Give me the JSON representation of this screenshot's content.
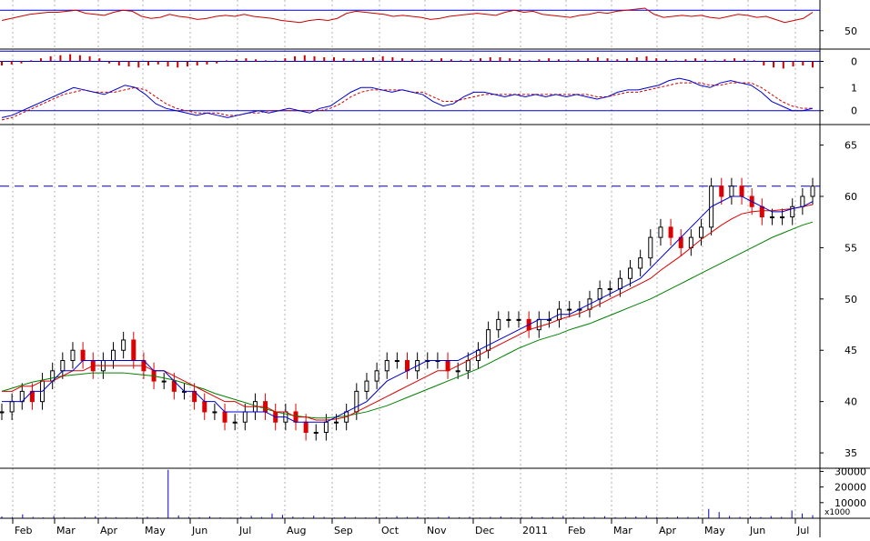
{
  "chart_data": {
    "type": "line",
    "title": "",
    "xlabel": "",
    "ylabel": "",
    "x_ticks": [
      "Feb",
      "Mar",
      "Apr",
      "May",
      "Jun",
      "Jul",
      "Aug",
      "Sep",
      "Oct",
      "Nov",
      "Dec",
      "2011",
      "Feb",
      "Mar",
      "Apr",
      "May",
      "Jun",
      "Jul"
    ],
    "grid": true,
    "panels": {
      "rsi": {
        "ylim": [
          32,
          80
        ],
        "ticks": [
          50
        ],
        "reference_lines": [
          70,
          30
        ],
        "color": "#cc0000",
        "values": [
          60,
          62,
          64,
          66,
          67,
          68,
          68,
          69,
          70,
          67,
          66,
          65,
          68,
          70,
          69,
          64,
          62,
          63,
          66,
          64,
          63,
          61,
          62,
          64,
          65,
          64,
          66,
          64,
          63,
          62,
          60,
          59,
          58,
          60,
          61,
          60,
          62,
          67,
          69,
          68,
          67,
          66,
          64,
          65,
          64,
          63,
          61,
          62,
          64,
          65,
          66,
          67,
          66,
          65,
          68,
          70,
          68,
          69,
          66,
          65,
          64,
          63,
          65,
          66,
          68,
          67,
          69,
          70,
          71,
          72,
          66,
          63,
          64,
          65,
          64,
          65,
          63,
          62,
          64,
          66,
          65,
          63,
          64,
          61,
          58,
          60,
          62,
          68
        ]
      },
      "macd_histogram": {
        "ylim": [
          -1.2,
          1.2
        ],
        "ticks": [
          0
        ],
        "color": "#cc0000",
        "values": [
          -0.4,
          -0.3,
          -0.2,
          0.1,
          0.3,
          0.5,
          0.6,
          0.7,
          0.6,
          0.5,
          0.3,
          -0.2,
          -0.4,
          -0.5,
          -0.6,
          -0.4,
          -0.3,
          -0.5,
          -0.6,
          -0.5,
          -0.4,
          -0.3,
          -0.2,
          0.1,
          0.2,
          0.3,
          0.2,
          0.1,
          0.1,
          0.3,
          0.5,
          0.6,
          0.5,
          0.4,
          0.4,
          0.3,
          0.2,
          0.3,
          0.4,
          0.5,
          0.4,
          0.3,
          0.2,
          0.1,
          0.2,
          0.3,
          0.2,
          0.1,
          0.2,
          0.3,
          0.4,
          0.4,
          0.3,
          0.2,
          0.1,
          0.2,
          0.3,
          0.2,
          0.1,
          0.2,
          0.3,
          0.4,
          0.3,
          0.2,
          0.3,
          0.4,
          0.5,
          0.3,
          0.2,
          0.1,
          0.2,
          0.3,
          0.2,
          0.1,
          0.2,
          0.3,
          0.2,
          0.1,
          -0.4,
          -0.6,
          -0.7,
          -0.5,
          -0.4,
          -0.6
        ]
      },
      "macd": {
        "ylim": [
          -0.6,
          1.6
        ],
        "ticks": [
          1,
          0
        ],
        "macd_color": "#0000cc",
        "signal_color": "#cc0000",
        "macd": [
          -0.3,
          -0.2,
          0.0,
          0.2,
          0.4,
          0.6,
          0.8,
          1.0,
          0.9,
          0.8,
          0.7,
          0.9,
          1.1,
          1.0,
          0.7,
          0.3,
          0.1,
          0.0,
          -0.1,
          -0.2,
          -0.1,
          -0.2,
          -0.3,
          -0.2,
          -0.1,
          0.0,
          -0.1,
          0.0,
          0.1,
          0.0,
          -0.1,
          0.1,
          0.2,
          0.5,
          0.8,
          1.0,
          1.0,
          0.9,
          0.8,
          0.9,
          0.8,
          0.7,
          0.4,
          0.2,
          0.3,
          0.6,
          0.8,
          0.8,
          0.7,
          0.6,
          0.7,
          0.6,
          0.7,
          0.6,
          0.7,
          0.6,
          0.7,
          0.6,
          0.5,
          0.6,
          0.8,
          0.9,
          0.9,
          1.0,
          1.1,
          1.3,
          1.4,
          1.3,
          1.1,
          1.0,
          1.2,
          1.3,
          1.2,
          1.1,
          0.8,
          0.4,
          0.2,
          0.0,
          0.0,
          0.1
        ],
        "signal": [
          -0.4,
          -0.3,
          -0.1,
          0.1,
          0.3,
          0.5,
          0.7,
          0.8,
          0.9,
          0.8,
          0.8,
          0.8,
          0.9,
          1.0,
          0.9,
          0.6,
          0.3,
          0.1,
          0.0,
          -0.1,
          -0.1,
          -0.1,
          -0.2,
          -0.2,
          -0.1,
          -0.1,
          0.0,
          0.0,
          0.0,
          0.0,
          0.0,
          0.0,
          0.1,
          0.3,
          0.6,
          0.8,
          0.9,
          0.9,
          0.9,
          0.9,
          0.8,
          0.8,
          0.6,
          0.4,
          0.4,
          0.5,
          0.6,
          0.7,
          0.7,
          0.7,
          0.7,
          0.7,
          0.7,
          0.7,
          0.7,
          0.7,
          0.7,
          0.7,
          0.6,
          0.6,
          0.7,
          0.8,
          0.8,
          0.9,
          1.0,
          1.1,
          1.2,
          1.2,
          1.2,
          1.1,
          1.1,
          1.2,
          1.2,
          1.2,
          1.0,
          0.7,
          0.4,
          0.2,
          0.1,
          0.1
        ]
      },
      "price": {
        "ylim": [
          33.5,
          67
        ],
        "ticks": [
          65,
          60,
          55,
          50,
          45,
          40,
          35
        ],
        "dashed_level": 61,
        "close": [
          39,
          40,
          41,
          40,
          42,
          43,
          44,
          45,
          44,
          43,
          44,
          45,
          46,
          44,
          43,
          42,
          42,
          41,
          41,
          40,
          39,
          39,
          38,
          38,
          39,
          40,
          39,
          38,
          39,
          38,
          37,
          37,
          38,
          38,
          39,
          41,
          42,
          43,
          44,
          44,
          43,
          44,
          44,
          44,
          43,
          43,
          44,
          45,
          47,
          48,
          48,
          48,
          47,
          48,
          48,
          49,
          49,
          49,
          50,
          51,
          51,
          52,
          53,
          54,
          56,
          57,
          56,
          55,
          56,
          57,
          61,
          60,
          61,
          60,
          59,
          58,
          58,
          58,
          59,
          60,
          61
        ],
        "ma_short": [
          40,
          40,
          40,
          41,
          41,
          42,
          43,
          43,
          44,
          44,
          44,
          44,
          44,
          44,
          44,
          43,
          43,
          42,
          41,
          41,
          40,
          40,
          39,
          39,
          39,
          39,
          39,
          38.5,
          38.5,
          38,
          38,
          38,
          38,
          38.5,
          39,
          39.5,
          40,
          41,
          42,
          42.5,
          43,
          43.5,
          44,
          44,
          44,
          44,
          44.5,
          45,
          45.5,
          46,
          46.5,
          47,
          47.5,
          48,
          48,
          48.5,
          48.5,
          49,
          49.5,
          50,
          50.5,
          51,
          51.5,
          52,
          53,
          54,
          55,
          56,
          57,
          58,
          59,
          59.5,
          60,
          60,
          59.5,
          59,
          58.5,
          58.5,
          58.8,
          59,
          59.5
        ],
        "ma_mid": [
          41,
          41,
          41.5,
          41.5,
          42,
          42,
          42.5,
          43,
          43,
          43.5,
          43.5,
          43.5,
          43.5,
          43.5,
          43.5,
          43,
          43,
          42.5,
          42,
          41.5,
          41,
          40.5,
          40,
          40,
          39.5,
          39.5,
          39.5,
          39,
          39,
          38.5,
          38.5,
          38.2,
          38.2,
          38.3,
          38.5,
          39,
          39.5,
          40,
          40.5,
          41,
          41.5,
          42,
          42.5,
          43,
          43,
          43.5,
          44,
          44.5,
          45,
          45.5,
          46,
          46.5,
          47,
          47.3,
          47.6,
          48,
          48.3,
          48.6,
          49,
          49.5,
          50,
          50.5,
          51,
          51.5,
          52,
          52.8,
          53.5,
          54.2,
          55,
          55.8,
          56.5,
          57.2,
          57.8,
          58.3,
          58.5,
          58.6,
          58.6,
          58.7,
          58.8,
          59,
          59.2
        ],
        "ma_long": [
          41,
          41.3,
          41.6,
          41.9,
          42.1,
          42.3,
          42.5,
          42.6,
          42.7,
          42.8,
          42.8,
          42.8,
          42.8,
          42.7,
          42.6,
          42.5,
          42.3,
          42.1,
          41.8,
          41.5,
          41.2,
          40.8,
          40.5,
          40.2,
          39.9,
          39.6,
          39.3,
          39,
          38.8,
          38.6,
          38.5,
          38.4,
          38.4,
          38.5,
          38.6,
          38.8,
          39,
          39.3,
          39.6,
          40,
          40.4,
          40.8,
          41.2,
          41.6,
          42,
          42.4,
          42.8,
          43.2,
          43.7,
          44.2,
          44.7,
          45.2,
          45.6,
          46,
          46.3,
          46.6,
          47,
          47.3,
          47.6,
          48,
          48.4,
          48.8,
          49.2,
          49.6,
          50,
          50.5,
          51,
          51.5,
          52,
          52.5,
          53,
          53.5,
          54,
          54.5,
          55,
          55.5,
          56,
          56.4,
          56.8,
          57.2,
          57.5
        ]
      },
      "volume": {
        "ylim": [
          0,
          32000
        ],
        "ticks": [
          "30000",
          "20000",
          "10000"
        ],
        "unit_label": "x1000",
        "color": "#0000cc",
        "values": [
          1200,
          800,
          2500,
          900,
          600,
          1500,
          700,
          400,
          1100,
          1300,
          900,
          700,
          500,
          800,
          1000,
          600,
          31000,
          1800,
          900,
          700,
          1200,
          600,
          400,
          900,
          1500,
          800,
          3000,
          2200,
          1100,
          700,
          1600,
          900,
          500,
          1200,
          800,
          600,
          1000,
          700,
          1400,
          900,
          1100,
          600,
          800,
          1300,
          700,
          1000,
          500,
          900,
          1200,
          600,
          800,
          1100,
          700,
          900,
          1500,
          600,
          1000,
          800,
          1300,
          700,
          900,
          1200,
          1600,
          800,
          700,
          1100,
          900,
          1000,
          6000,
          4000,
          1500,
          900,
          1200,
          800,
          1400,
          900,
          5000,
          3000,
          2000
        ]
      }
    }
  }
}
